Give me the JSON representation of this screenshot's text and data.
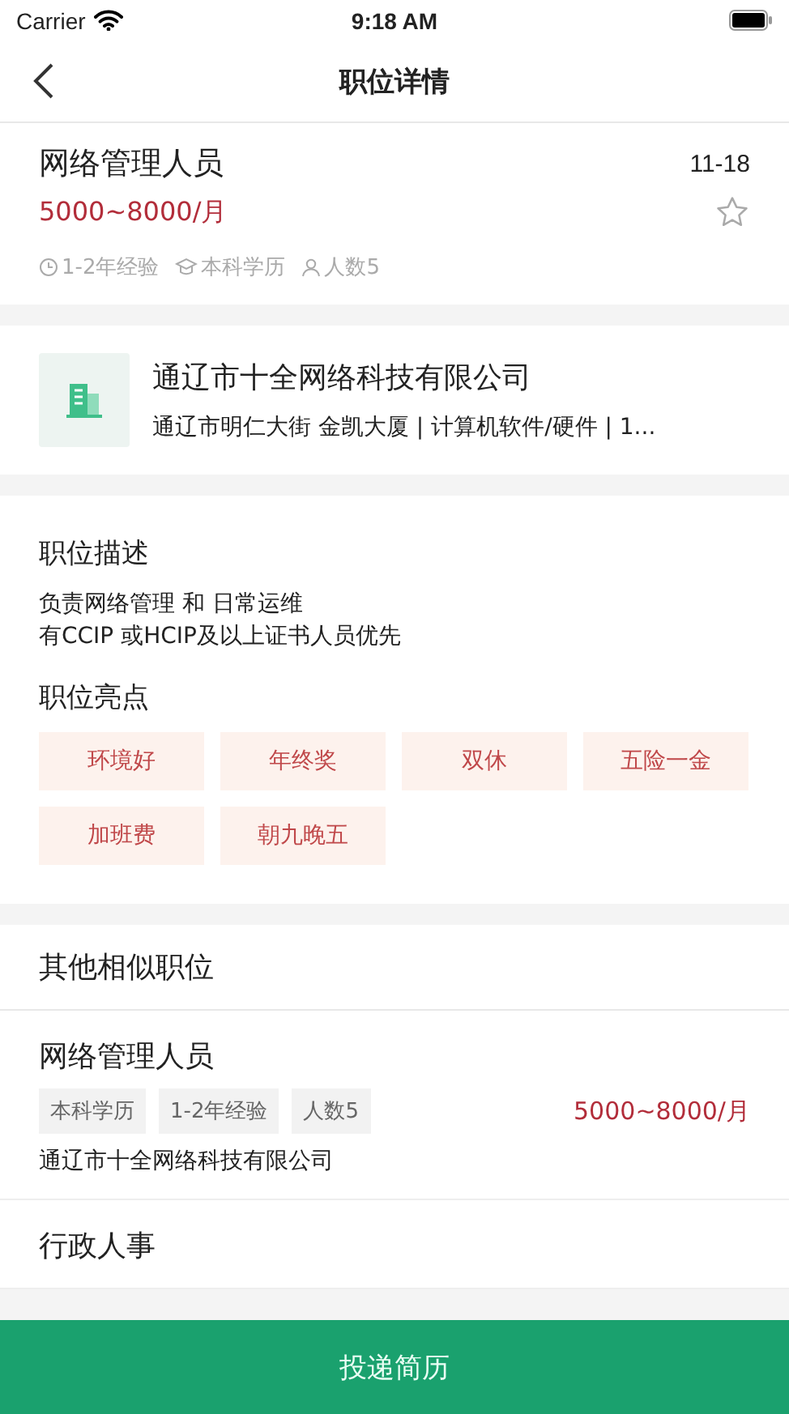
{
  "status_bar": {
    "carrier": "Carrier",
    "time": "9:18 AM"
  },
  "nav": {
    "title": "职位详情"
  },
  "job": {
    "title": "网络管理人员",
    "date": "11-18",
    "salary": "5000~8000/月",
    "favorited": false,
    "meta": [
      {
        "kind": "clock",
        "text": "1-2年经验"
      },
      {
        "kind": "cap",
        "text": "本科学历"
      },
      {
        "kind": "person",
        "text": "人数5"
      }
    ]
  },
  "company": {
    "name": "通辽市十全网络科技有限公司",
    "info": "通辽市明仁大街 金凯大厦  | 计算机软件/硬件 | 1..."
  },
  "description": {
    "heading": "职位描述",
    "lines": [
      "负责网络管理 和 日常运维",
      "有CCIP 或HCIP及以上证书人员优先"
    ]
  },
  "highlights": {
    "heading": "职位亮点",
    "tags": [
      "环境好",
      "年终奖",
      "双休",
      "五险一金",
      "加班费",
      "朝九晚五"
    ]
  },
  "similar": {
    "heading": "其他相似职位",
    "items": [
      {
        "title": "网络管理人员",
        "tags": [
          "本科学历",
          "1-2年经验",
          "人数5"
        ],
        "salary": "5000~8000/月",
        "company": "通辽市十全网络科技有限公司"
      },
      {
        "title": "行政人事"
      }
    ]
  },
  "submit_button": "投递简历"
}
